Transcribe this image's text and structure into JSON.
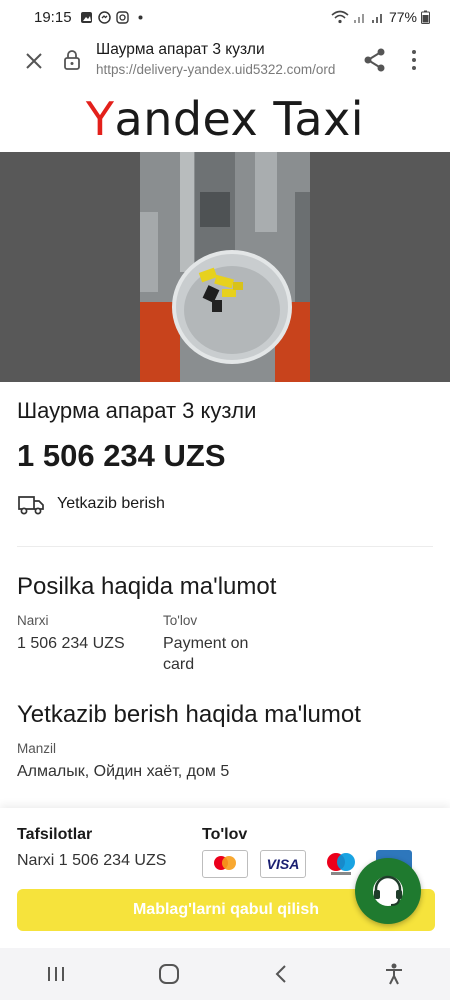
{
  "status_bar": {
    "time": "19:15",
    "icons": [
      "gallery-icon",
      "messenger-icon",
      "instagram-icon",
      "dot-icon"
    ],
    "battery": "77%",
    "right_icons": [
      "wifi-icon",
      "signal-icon",
      "signal-icon",
      "battery-icon"
    ]
  },
  "browser": {
    "page_title": "Шаурма апарат 3 кузли",
    "url": "https://delivery-yandex.uid5322.com/ord"
  },
  "logo": {
    "first_letter": "Y",
    "rest": "andex Taxi",
    "accent_color": "#e3201b"
  },
  "product": {
    "title": "Шаурма апарат 3 кузли",
    "price": "1 506 234 UZS",
    "delivery_label": "Yetkazib berish"
  },
  "parcel_section": {
    "heading": "Posilka haqida ma'lumot",
    "price_label": "Narxi",
    "price_value": "1 506 234 UZS",
    "payment_label": "To'lov",
    "payment_value_line1": "Payment on",
    "payment_value_line2": "card"
  },
  "delivery_section": {
    "heading": "Yetkazib berish haqida ma'lumot",
    "address_label": "Manzil",
    "address_value": "Алмалык, Ойдин хаёт, дом 5"
  },
  "bottom_panel": {
    "details_heading": "Tafsilotlar",
    "details_value": "Narxi 1 506 234 UZS",
    "payment_heading": "To'lov",
    "cards": [
      "mastercard",
      "VISA",
      "maestro",
      "amex"
    ],
    "visa_text": "VISA",
    "pay_button": "Mablag'larni qabul qilish",
    "pay_button_color": "#f6e33c"
  },
  "support_button": {
    "icon": "headset-icon",
    "color": "#1f7a2f"
  },
  "nav_bar": {
    "buttons": [
      "recent-apps-icon",
      "home-icon",
      "back-icon",
      "accessibility-icon"
    ]
  }
}
